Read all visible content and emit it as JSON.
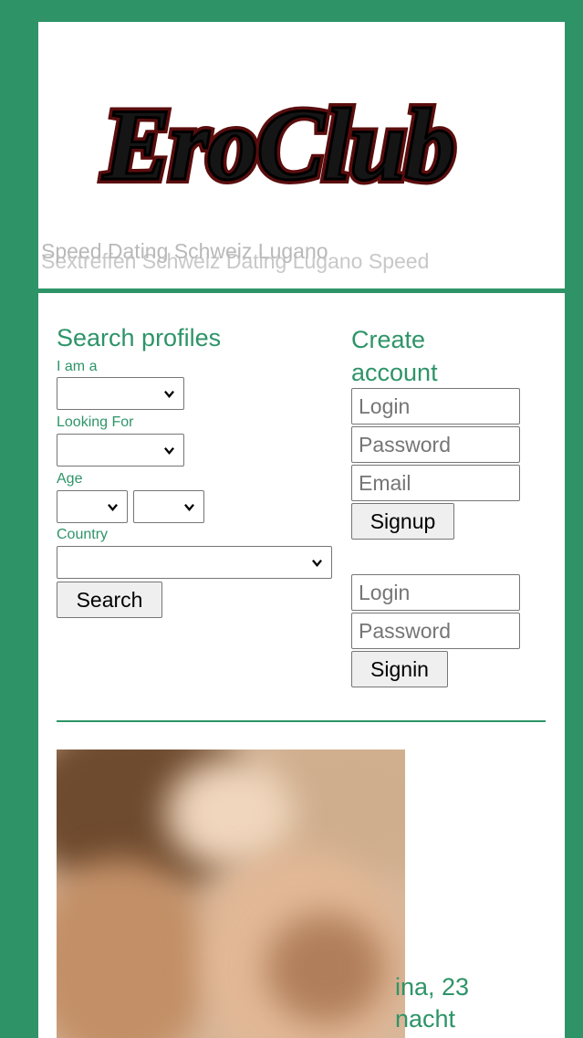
{
  "header": {
    "logo_text": "EroClub",
    "subtitle_front": "Speed Dating Schweiz Lugano",
    "subtitle_back": "Sextreffen Schweiz Dating Lugano Speed"
  },
  "search": {
    "title": "Search profiles",
    "i_am_label": "I am a",
    "looking_for_label": "Looking For",
    "age_label": "Age",
    "country_label": "Country",
    "search_button": "Search"
  },
  "signup": {
    "title": "Create account",
    "login_placeholder": "Login",
    "password_placeholder": "Password",
    "email_placeholder": "Email",
    "signup_button": "Signup"
  },
  "signin": {
    "login_placeholder": "Login",
    "password_placeholder": "Password",
    "signin_button": "Signin"
  },
  "profile": {
    "name_age": "ina, 23",
    "city": "nacht"
  },
  "colors": {
    "accent": "#2e9468",
    "background": "#2e9468",
    "panel": "#ffffff"
  }
}
